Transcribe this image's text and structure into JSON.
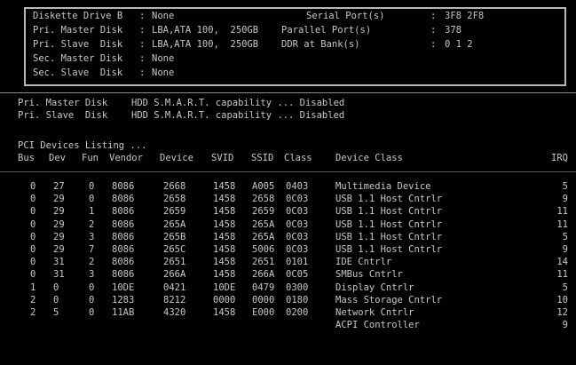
{
  "summary": {
    "left_rows": [
      {
        "label": "Diskette Drive B",
        "value": "None"
      },
      {
        "label": "Pri. Master Disk",
        "value": "LBA,ATA 100,  250GB"
      },
      {
        "label": "Pri. Slave  Disk",
        "value": "LBA,ATA 100,  250GB"
      },
      {
        "label": "Sec. Master Disk",
        "value": "None"
      },
      {
        "label": "Sec. Slave  Disk",
        "value": "None"
      }
    ],
    "right_rows": [
      {
        "label": "Serial Port(s)",
        "value": "3F8 2F8"
      },
      {
        "label": "Parallel Port(s)",
        "value": "378"
      },
      {
        "label": "DDR at Bank(s)",
        "value": "0 1 2"
      }
    ],
    "separator": ":"
  },
  "smart": [
    {
      "device": "Pri. Master Disk",
      "text": "HDD S.M.A.R.T. capability ... Disabled"
    },
    {
      "device": "Pri. Slave  Disk",
      "text": "HDD S.M.A.R.T. capability ... Disabled"
    }
  ],
  "pci": {
    "title": "PCI Devices Listing ...",
    "headers": [
      "Bus",
      "Dev",
      "Fun",
      "Vendor",
      "Device",
      "SVID",
      "SSID",
      "Class",
      "Device Class",
      "IRQ"
    ],
    "rows": [
      [
        "0",
        "27",
        "0",
        "8086",
        "2668",
        "1458",
        "A005",
        "0403",
        "Multimedia Device",
        "5"
      ],
      [
        "0",
        "29",
        "0",
        "8086",
        "2658",
        "1458",
        "2658",
        "0C03",
        "USB 1.1 Host Cntrlr",
        "9"
      ],
      [
        "0",
        "29",
        "1",
        "8086",
        "2659",
        "1458",
        "2659",
        "0C03",
        "USB 1.1 Host Cntrlr",
        "11"
      ],
      [
        "0",
        "29",
        "2",
        "8086",
        "265A",
        "1458",
        "265A",
        "0C03",
        "USB 1.1 Host Cntrlr",
        "11"
      ],
      [
        "0",
        "29",
        "3",
        "8086",
        "265B",
        "1458",
        "265A",
        "0C03",
        "USB 1.1 Host Cntrlr",
        "5"
      ],
      [
        "0",
        "29",
        "7",
        "8086",
        "265C",
        "1458",
        "5006",
        "0C03",
        "USB 1.1 Host Cntrlr",
        "9"
      ],
      [
        "0",
        "31",
        "2",
        "8086",
        "2651",
        "1458",
        "2651",
        "0101",
        "IDE Cntrlr",
        "14"
      ],
      [
        "0",
        "31",
        "3",
        "8086",
        "266A",
        "1458",
        "266A",
        "0C05",
        "SMBus Cntrlr",
        "11"
      ],
      [
        "1",
        "0",
        "0",
        "10DE",
        "0421",
        "10DE",
        "0479",
        "0300",
        "Display Cntrlr",
        "5"
      ],
      [
        "2",
        "0",
        "0",
        "1283",
        "8212",
        "0000",
        "0000",
        "0180",
        "Mass Storage Cntrlr",
        "10"
      ],
      [
        "2",
        "5",
        "0",
        "11AB",
        "4320",
        "1458",
        "E000",
        "0200",
        "Network Cntrlr",
        "12"
      ],
      [
        "",
        "",
        "",
        "",
        "",
        "",
        "",
        "",
        "ACPI Controller",
        "9"
      ]
    ]
  }
}
